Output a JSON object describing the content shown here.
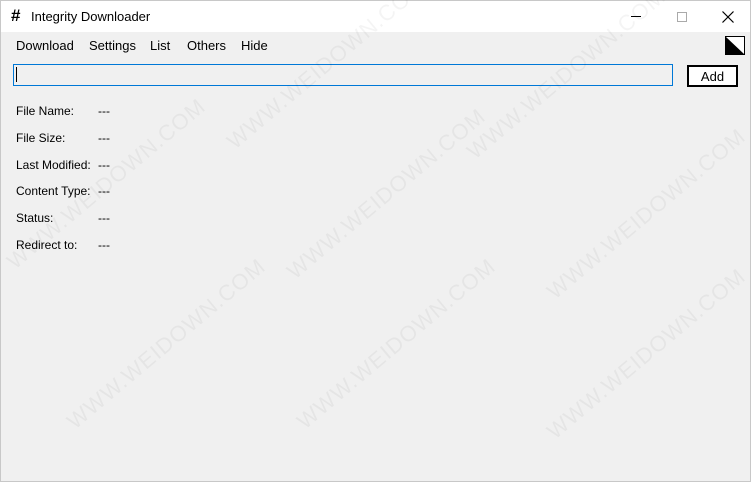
{
  "window": {
    "title": "Integrity Downloader",
    "app_icon_glyph": "#"
  },
  "menu": {
    "items": [
      "Download",
      "Settings",
      "List",
      "Others",
      "Hide"
    ]
  },
  "url_input": {
    "value": ""
  },
  "add_button": {
    "label": "Add"
  },
  "info": {
    "rows": [
      {
        "label": "File Name:",
        "value": "---"
      },
      {
        "label": "File Size:",
        "value": "---"
      },
      {
        "label": "Last Modified:",
        "value": "---"
      },
      {
        "label": "Content Type:",
        "value": "---"
      },
      {
        "label": "Status:",
        "value": "---"
      },
      {
        "label": "Redirect to:",
        "value": "---"
      }
    ]
  },
  "watermark": {
    "text": "WWW.WEIDOWN.COM"
  },
  "icons": {
    "app": "hash-icon",
    "minimize": "minimize-icon",
    "maximize": "maximize-icon",
    "close": "close-icon",
    "theme": "theme-toggle-icon"
  }
}
